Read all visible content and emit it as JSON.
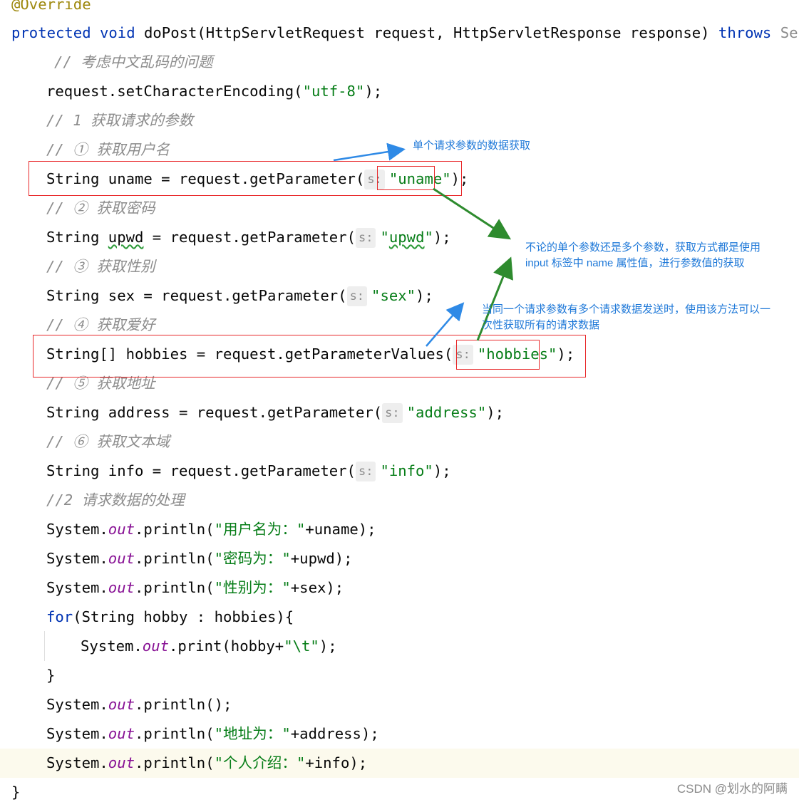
{
  "code": {
    "annotation": "@Override",
    "sig_protected": "protected",
    "sig_void": "void",
    "sig_name_params": " doPost(HttpServletRequest request, HttpServletResponse response) ",
    "sig_throws": "throws",
    "sig_rest": " Servl",
    "cmt_encoding": "// 考虑中文乱码的问题",
    "enc_pre": "request.setCharacterEncoding(",
    "enc_str": "\"utf-8\"",
    "enc_post": ");",
    "cmt_step1": "// 1 获取请求的参数",
    "cmt_c1": "// ① 获取用户名",
    "uname_pre": "String uname = request.getParameter(",
    "uname_str": "\"uname\"",
    "uname_post": ");",
    "cmt_c2": "// ② 获取密码",
    "upwd_pre1": "String ",
    "upwd_var": "upwd",
    "upwd_pre2": " = request.getParameter(",
    "upwd_str_q1": "\"",
    "upwd_str_body": "upwd",
    "upwd_str_q2": "\"",
    "upwd_post": ");",
    "cmt_c3": "// ③ 获取性别",
    "sex_pre": "String sex = request.getParameter(",
    "sex_str": "\"sex\"",
    "sex_post": ");",
    "cmt_c4": "// ④ 获取爱好",
    "hob_pre": "String[] hobbies = request.getParameterValues(",
    "hob_str": "\"hobbies\"",
    "hob_post": ");",
    "cmt_c5": "// ⑤ 获取地址",
    "addr_pre": "String address = request.getParameter(",
    "addr_str": "\"address\"",
    "addr_post": ");",
    "cmt_c6": "// ⑥ 获取文本域",
    "info_pre": "String info = request.getParameter(",
    "info_str": "\"info\"",
    "info_post": ");",
    "cmt_step2": "//2 请求数据的处理",
    "sys": "System.",
    "out": "out",
    "println_open": ".println(",
    "p1_str": "\"用户名为：\"",
    "p1_post": "+uname);",
    "p2_str": "\"密码为：\"",
    "p2_post": "+upwd);",
    "p3_str": "\"性别为：\"",
    "p3_post": "+sex);",
    "for_kw": "for",
    "for_rest": "(String hobby : hobbies){",
    "print_open": ".print(hobby+",
    "tab_str": "\"\\t\"",
    "print_post": ");",
    "close_brace": "}",
    "println_empty": ".println();",
    "p5_str": "\"地址为：\"",
    "p5_post": "+address);",
    "p6_str": "\"个人介绍：\"",
    "p6_post": "+info);",
    "end_brace": "}",
    "hint_label": "s:"
  },
  "notes": {
    "single": "单个请求参数的数据获取",
    "both_line1": "不论的单个参数还是多个参数，获取方式都是使用",
    "both_line2": "input 标签中 name 属性值，进行参数值的获取",
    "multi_line1": "当同一个请求参数有多个请求数据发送时，使用该方法可以一",
    "multi_line2": "次性获取所有的请求数据"
  },
  "watermark": "CSDN @划水的阿瞒",
  "colors": {
    "keyword": "#0033b3",
    "string": "#067d17",
    "comment": "#8c8c8c",
    "field": "#871094",
    "annotation": "#9e880d",
    "red_box": "#e8292b",
    "blue_note": "#1e78d8",
    "green_arrow": "#2e8b2e"
  }
}
